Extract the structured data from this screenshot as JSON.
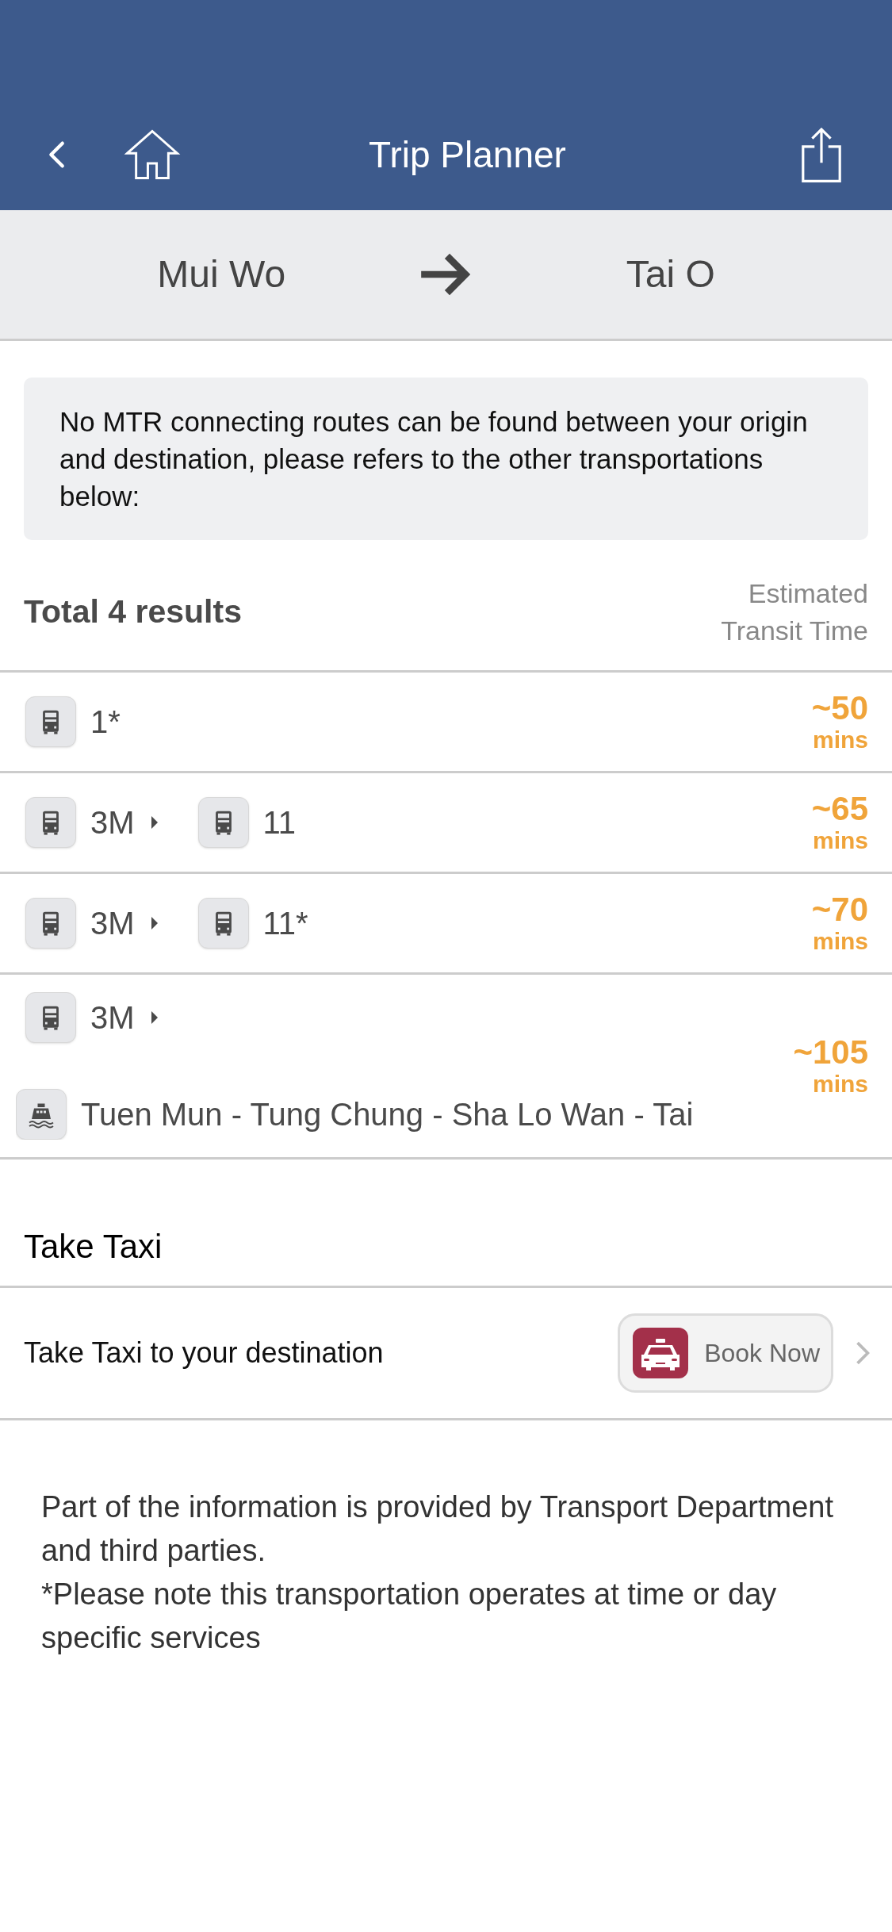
{
  "header": {
    "title": "Trip Planner"
  },
  "route": {
    "origin": "Mui Wo",
    "destination": "Tai O"
  },
  "notice": "No MTR connecting routes can be found between your origin and destination, please refers to the other transportations below:",
  "results_header": {
    "title": "Total 4 results",
    "time_label": "Estimated Transit Time"
  },
  "results": [
    {
      "legs": [
        {
          "kind": "bus",
          "route": "1*"
        }
      ],
      "time": "~50",
      "unit": "mins"
    },
    {
      "legs": [
        {
          "kind": "bus",
          "route": "3M"
        },
        {
          "kind": "bus",
          "route": "11"
        }
      ],
      "time": "~65",
      "unit": "mins"
    },
    {
      "legs": [
        {
          "kind": "bus",
          "route": "3M"
        },
        {
          "kind": "bus",
          "route": "11*"
        }
      ],
      "time": "~70",
      "unit": "mins"
    },
    {
      "legs": [
        {
          "kind": "bus",
          "route": "3M"
        },
        {
          "kind": "ferry",
          "route": "Tuen Mun - Tung Chung - Sha Lo Wan - Tai"
        }
      ],
      "time": "~105",
      "unit": "mins"
    }
  ],
  "taxi": {
    "heading": "Take Taxi",
    "label": "Take Taxi to your destination",
    "button": "Book Now"
  },
  "footer": [
    "Part of the information is provided by Transport Department and third parties.",
    "*Please note this transportation operates at time or day specific services"
  ]
}
